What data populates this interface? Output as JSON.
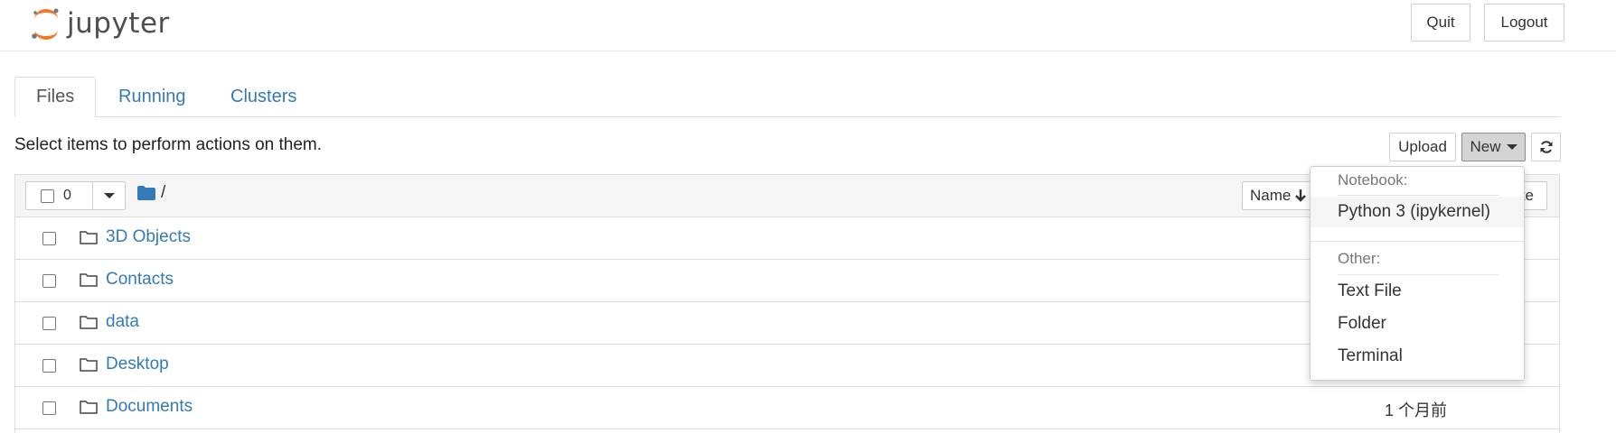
{
  "header": {
    "logo_text": "jupyter",
    "quit_label": "Quit",
    "logout_label": "Logout"
  },
  "tabs": [
    {
      "label": "Files",
      "active": true
    },
    {
      "label": "Running",
      "active": false
    },
    {
      "label": "Clusters",
      "active": false
    }
  ],
  "toolbar": {
    "hint": "Select items to perform actions on them.",
    "upload_label": "Upload",
    "new_label": "New",
    "selected_count": "0",
    "path_separator": "/"
  },
  "list_header": {
    "sort_name_label": "Name",
    "sort_modified_label": "te"
  },
  "files": [
    {
      "name": "3D Objects",
      "modified": ""
    },
    {
      "name": "Contacts",
      "modified": ""
    },
    {
      "name": "data",
      "modified": ""
    },
    {
      "name": "Desktop",
      "modified": ""
    },
    {
      "name": "Documents",
      "modified": "1 个月前"
    }
  ],
  "new_menu": {
    "notebook_header": "Notebook:",
    "python_kernel": "Python 3 (ipykernel)",
    "other_header": "Other:",
    "text_file": "Text File",
    "folder": "Folder",
    "terminal": "Terminal"
  },
  "colors": {
    "link": "#337ab7",
    "logo_orange": "#f37726",
    "logo_gray": "#767677"
  },
  "icons": [
    "jupyter-logo-icon",
    "folder-icon",
    "caret-down-icon",
    "refresh-icon",
    "sort-arrow-down-icon",
    "folder-outline-icon"
  ]
}
